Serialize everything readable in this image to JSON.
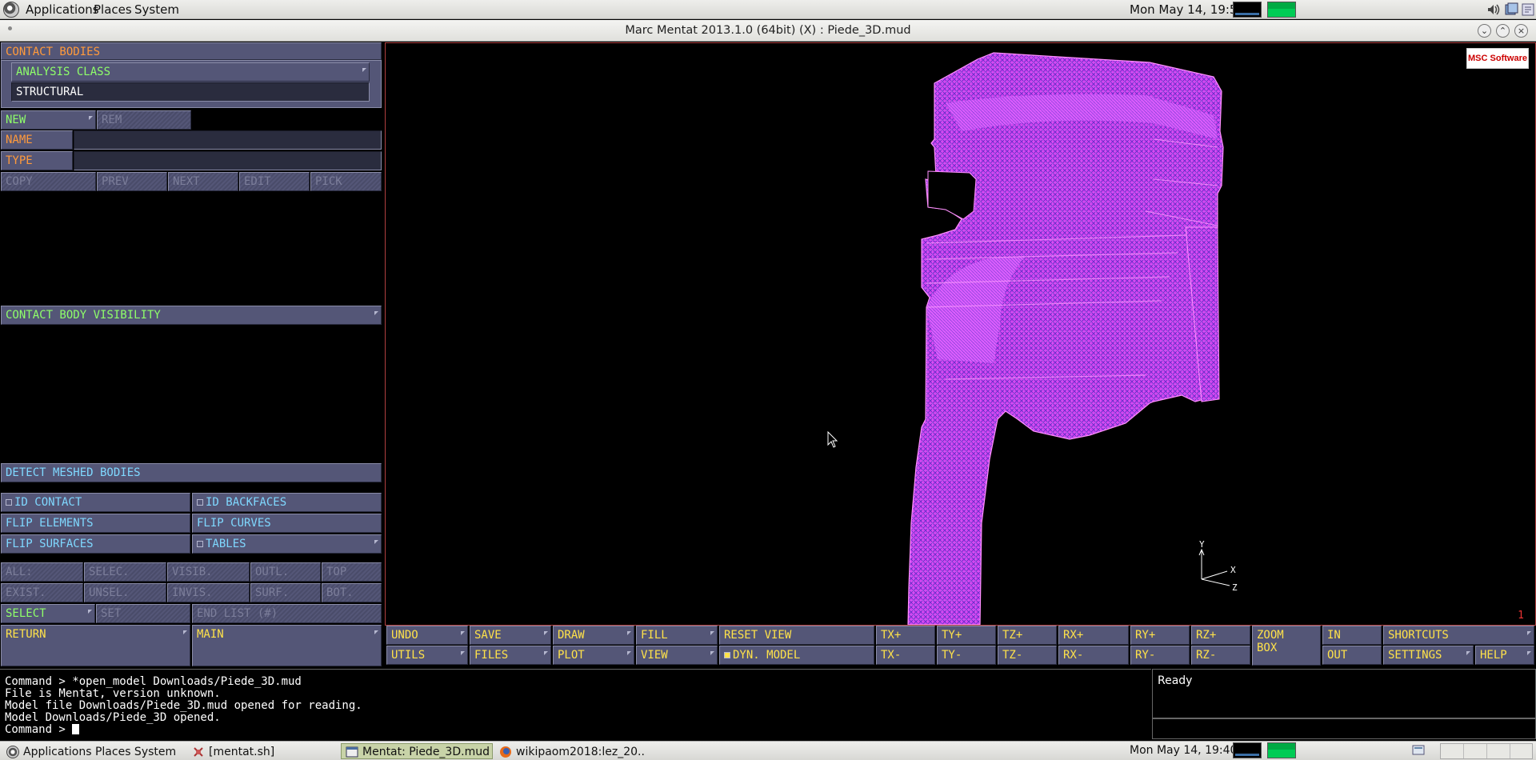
{
  "top_panel": {
    "menus": [
      "Applications",
      "Places",
      "System"
    ],
    "clock": "Mon May 14, 19:50"
  },
  "window": {
    "title": "Marc Mentat 2013.1.0 (64bit) (X) : Piede_3D.mud"
  },
  "left_menu": {
    "contact_bodies": "CONTACT BODIES",
    "analysis_class": "ANALYSIS CLASS",
    "analysis_class_value": "STRUCTURAL",
    "new": "NEW",
    "rem": "REM",
    "name": "NAME",
    "name_value": "",
    "type": "TYPE",
    "type_value": "",
    "row_ops": [
      "COPY",
      "PREV",
      "NEXT",
      "EDIT",
      "PICK"
    ],
    "visibility": "CONTACT BODY VISIBILITY",
    "detect": "DETECT MESHED BODIES",
    "id_contact": "ID CONTACT",
    "id_backfaces": "ID BACKFACES",
    "flip_elements": "FLIP ELEMENTS",
    "flip_curves": "FLIP CURVES",
    "flip_surfaces": "FLIP SURFACES",
    "tables": "TABLES",
    "select_row1": [
      "ALL:",
      "SELEC.",
      "VISIB.",
      "OUTL.",
      "TOP"
    ],
    "select_row2": [
      "EXIST.",
      "UNSEL.",
      "INVIS.",
      "SURF.",
      "BOT."
    ],
    "select": "SELECT",
    "set": "SET",
    "end_list": "END LIST (#)",
    "return": "RETURN",
    "main": "MAIN"
  },
  "viewport": {
    "logo_text": "MSC Software",
    "number": "1",
    "axes": [
      "Y",
      "X",
      "Z"
    ]
  },
  "toolbar": {
    "undo": "UNDO",
    "save": "SAVE",
    "draw": "DRAW",
    "fill": "FILL",
    "reset_view": "RESET VIEW",
    "tx_plus": "TX+",
    "ty_plus": "TY+",
    "tz_plus": "TZ+",
    "rx_plus": "RX+",
    "ry_plus": "RY+",
    "rz_plus": "RZ+",
    "zoom_box": "ZOOM BOX",
    "in": "IN",
    "shortcuts": "SHORTCUTS",
    "utils": "UTILS",
    "files": "FILES",
    "plot": "PLOT",
    "view": "VIEW",
    "dyn_model": "DYN. MODEL",
    "tx_minus": "TX-",
    "ty_minus": "TY-",
    "tz_minus": "TZ-",
    "rx_minus": "RX-",
    "ry_minus": "RY-",
    "rz_minus": "RZ-",
    "out": "OUT",
    "settings": "SETTINGS",
    "help": "HELP"
  },
  "command": {
    "lines": [
      "Command > *open_model Downloads/Piede_3D.mud",
      "File is Mentat, version unknown.",
      "Model file Downloads/Piede_3D.mud opened for reading.",
      "Model Downloads/Piede_3D opened."
    ],
    "prompt": "Command > ",
    "status": "Ready"
  },
  "taskbar": {
    "tasks": [
      "Applications Places System",
      "[mentat.sh]",
      "Mentat: Piede_3D.mud",
      "wikipaom2018:lez_20..."
    ],
    "clock": "Mon May 14, 19:40"
  },
  "colors": {
    "button_bg": "#545677",
    "label_yellow": "#ffe24a",
    "title_orange": "#ff9a3c",
    "mesh_magenta": "#e040ff",
    "mesh_blue": "#3040c0"
  }
}
